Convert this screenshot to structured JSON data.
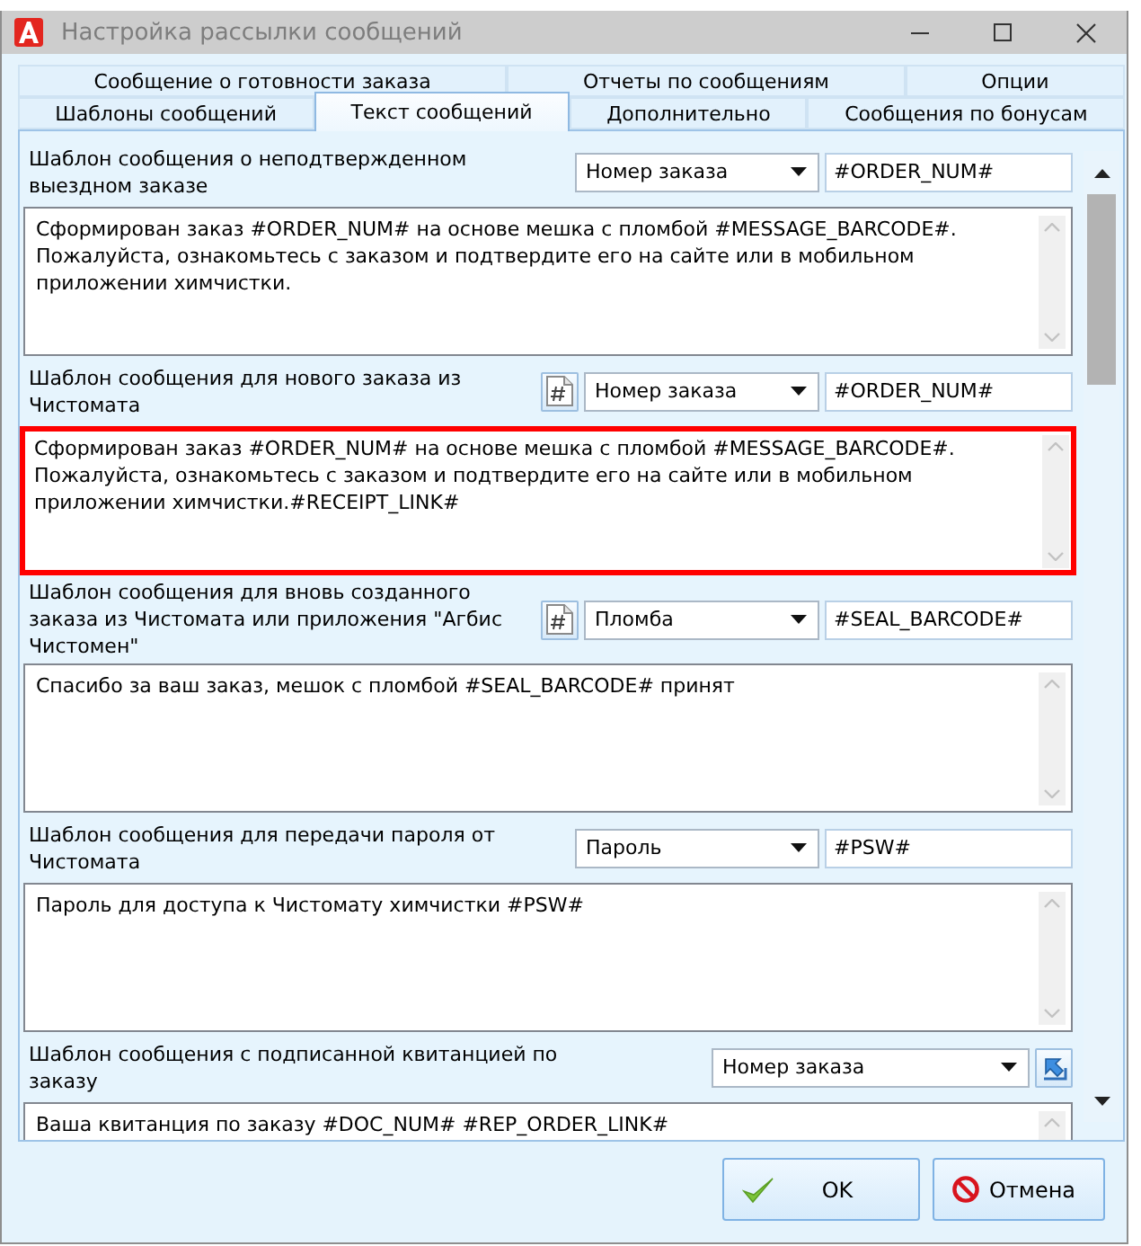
{
  "window": {
    "title": "Настройка рассылки сообщений"
  },
  "tab_rows": [
    {
      "tabs": [
        {
          "label": "Сообщение о готовности заказа",
          "selected": false
        },
        {
          "label": "Отчеты по сообщениям",
          "selected": false
        },
        {
          "label": "Опции",
          "selected": false
        }
      ]
    },
    {
      "tabs": [
        {
          "label": "Шаблоны сообщений",
          "selected": false
        },
        {
          "label": "Текст сообщений",
          "selected": true
        },
        {
          "label": "Дополнительно",
          "selected": false
        },
        {
          "label": "Сообщения по бонусам",
          "selected": false
        }
      ]
    }
  ],
  "templates": [
    {
      "label": "Шаблон сообщения о неподтвержденном выездном заказе",
      "variable": "Номер заказа",
      "code": "#ORDER_NUM#",
      "message": "Сформирован заказ #ORDER_NUM# на основе мешка с пломбой #MESSAGE_BARCODE#. Пожалуйста, ознакомьтесь с заказом и подтвердите его на сайте или в мобильном приложении химчистки.",
      "highlighted": false
    },
    {
      "label": "Шаблон сообщения для нового заказа из Чистомата",
      "tool": {
        "kind": "insert"
      },
      "variable": "Номер заказа",
      "code": "#ORDER_NUM#",
      "message": "Сформирован заказ #ORDER_NUM# на основе мешка с пломбой #MESSAGE_BARCODE#. Пожалуйста, ознакомьтесь с заказом и подтвердите его на сайте или в мобильном приложении химчистки.#RECEIPT_LINK#",
      "highlighted": true
    },
    {
      "label": "Шаблон сообщения для вновь созданного заказа из Чистомата или приложения \"Агбис Чистомен\"",
      "tool": {
        "kind": "insert"
      },
      "variable": "Пломба",
      "code": "#SEAL_BARCODE#",
      "message": "Спасибо за ваш заказ, мешок с пломбой #SEAL_BARCODE# принят",
      "highlighted": false
    },
    {
      "label": "Шаблон сообщения для передачи пароля от Чистомата",
      "variable": "Пароль",
      "code": "#PSW#",
      "message": "Пароль для доступа к Чистомату химчистки #PSW#",
      "highlighted": false
    },
    {
      "label": "Шаблон сообщения с подписанной квитанцией по заказу",
      "tool": {
        "kind": "link"
      },
      "variable": "Номер заказа",
      "message": "Ваша квитанция по заказу #DOC_NUM# #REP_ORDER_LINK#",
      "highlighted": false
    }
  ],
  "buttons": [
    {
      "kind": "ok",
      "label": "OK"
    },
    {
      "kind": "cancel",
      "label": "Отмена"
    }
  ]
}
